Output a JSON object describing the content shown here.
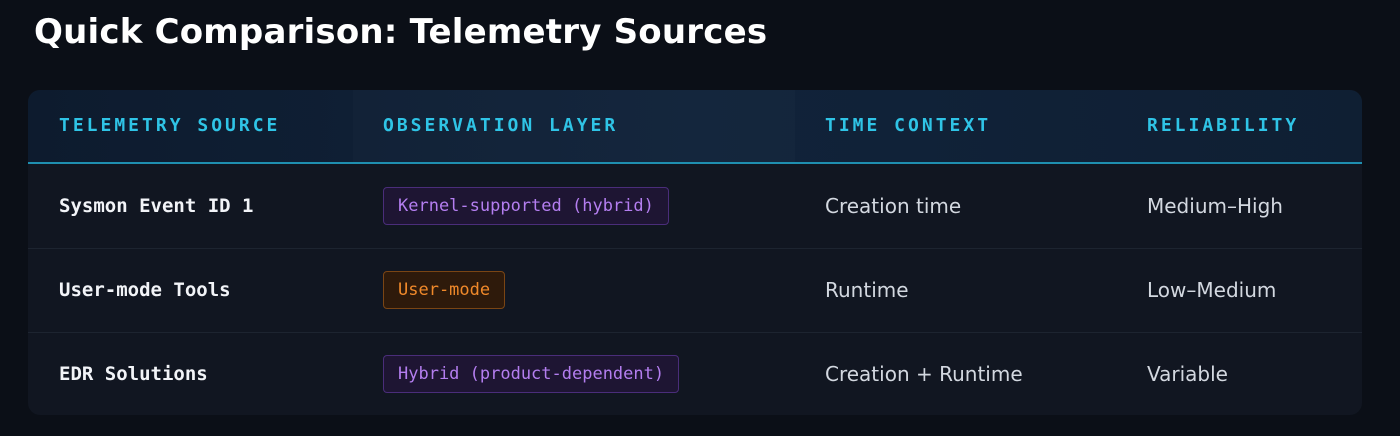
{
  "page": {
    "title": "Quick Comparison: Telemetry Sources"
  },
  "table": {
    "headers": [
      "TELEMETRY SOURCE",
      "OBSERVATION LAYER",
      "TIME CONTEXT",
      "RELIABILITY"
    ],
    "rows": [
      {
        "source": "Sysmon Event ID 1",
        "layer": "Kernel-supported (hybrid)",
        "layer_style": "purple",
        "time": "Creation time",
        "reliability": "Medium–High"
      },
      {
        "source": "User-mode Tools",
        "layer": "User-mode",
        "layer_style": "orange",
        "time": "Runtime",
        "reliability": "Low–Medium"
      },
      {
        "source": "EDR Solutions",
        "layer": "Hybrid (product-dependent)",
        "layer_style": "purple",
        "time": "Creation + Runtime",
        "reliability": "Variable"
      }
    ]
  },
  "colors": {
    "background": "#0b0f17",
    "header_text": "#2fc4e6",
    "accent_line": "#1f8fb0",
    "badge_purple": "#b47ef0",
    "badge_orange": "#f0892a"
  }
}
